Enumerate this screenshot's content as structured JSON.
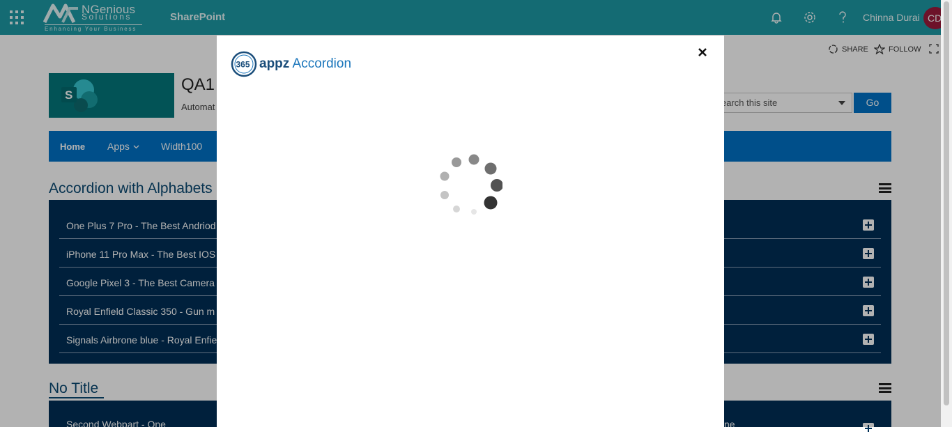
{
  "suitebar": {
    "app_name": "SharePoint",
    "logo_line1": "NGenious",
    "logo_line2": "Solutions",
    "logo_tagline": "Enhancing Your Business",
    "user_name": "Chinna Durai",
    "avatar_initials": "CD",
    "color": "#1e9aa5"
  },
  "actions": {
    "share": "SHARE",
    "follow": "FOLLOW"
  },
  "site": {
    "logo_letter": "S",
    "title": "QA1",
    "description": "Automat",
    "search_placeholder": "earch this site",
    "go_label": "Go"
  },
  "nav": {
    "items": [
      "Home",
      "Apps",
      "Width100"
    ]
  },
  "webpart1": {
    "title": "Accordion with Alphabets",
    "items": [
      "One Plus 7 Pro - The Best Andriod",
      "iPhone 11 Pro Max - The Best IOS",
      "Google Pixel 3 - The Best Camera",
      "Royal Enfield Classic 350 - Gun m",
      "Signals Airbrone blue - Royal Enfie"
    ]
  },
  "webpart2": {
    "title": "No Title",
    "first_item": "Second Webpart - One",
    "right_fragment": "ne"
  },
  "modal": {
    "brand_badge": "365",
    "brand_app": "appz",
    "brand_product": "Accordion",
    "close_symbol": "✕"
  }
}
